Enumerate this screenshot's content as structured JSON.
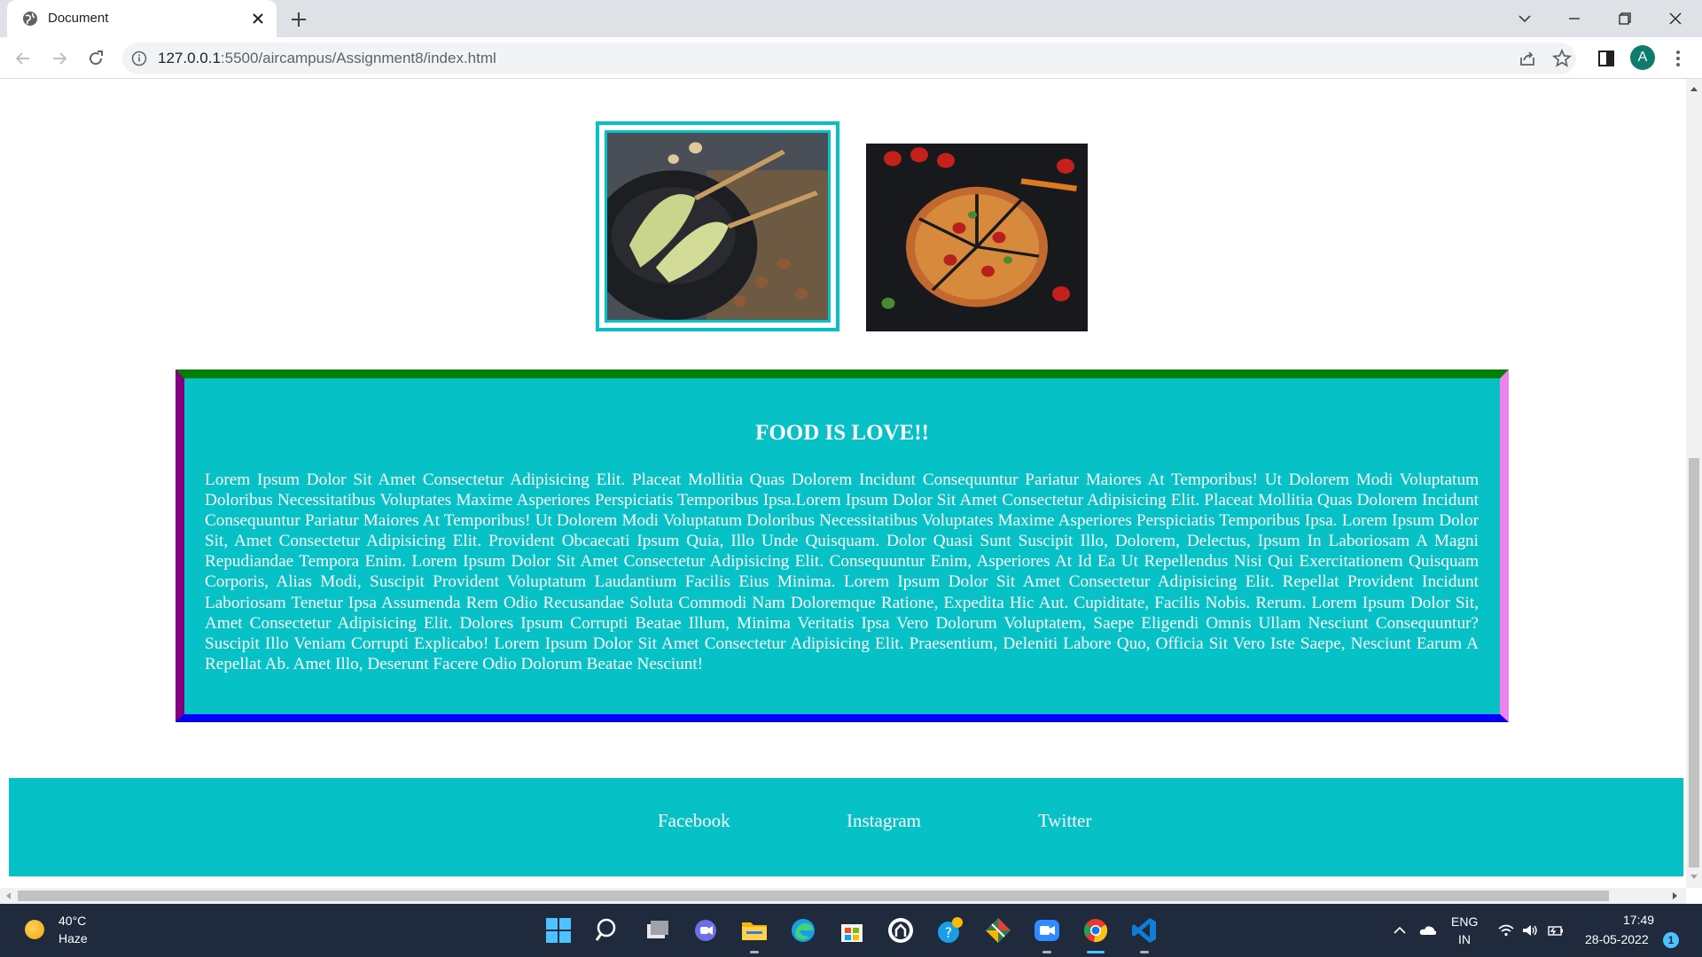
{
  "browser": {
    "tab_title": "Document",
    "url_host": "127.0.0.1",
    "url_rest": ":5500/aircampus/Assignment8/index.html",
    "avatar_letter": "A"
  },
  "page": {
    "heading": "FOOD IS LOVE!!",
    "paragraph": "Lorem Ipsum Dolor Sit Amet Consectetur Adipisicing Elit. Placeat Mollitia Quas Dolorem Incidunt Consequuntur Pariatur Maiores At Temporibus! Ut Dolorem Modi Voluptatum Doloribus Necessitatibus Voluptates Maxime Asperiores Perspiciatis Temporibus Ipsa.Lorem Ipsum Dolor Sit Amet Consectetur Adipisicing Elit. Placeat Mollitia Quas Dolorem Incidunt Consequuntur Pariatur Maiores At Temporibus! Ut Dolorem Modi Voluptatum Doloribus Necessitatibus Voluptates Maxime Asperiores Perspiciatis Temporibus Ipsa. Lorem Ipsum Dolor Sit, Amet Consectetur Adipisicing Elit. Provident Obcaecati Ipsum Quia, Illo Unde Quisquam. Dolor Quasi Sunt Suscipit Illo, Dolorem, Delectus, Ipsum In Laboriosam A Magni Repudiandae Tempora Enim. Lorem Ipsum Dolor Sit Amet Consectetur Adipisicing Elit. Consequuntur Enim, Asperiores At Id Ea Ut Repellendus Nisi Qui Exercitationem Quisquam Corporis, Alias Modi, Suscipit Provident Voluptatum Laudantium Facilis Eius Minima. Lorem Ipsum Dolor Sit Amet Consectetur Adipisicing Elit. Repellat Provident Incidunt Laboriosam Tenetur Ipsa Assumenda Rem Odio Recusandae Soluta Commodi Nam Doloremque Ratione, Expedita Hic Aut. Cupiditate, Facilis Nobis. Rerum. Lorem Ipsum Dolor Sit, Amet Consectetur Adipisicing Elit. Dolores Ipsum Corrupti Beatae Illum, Minima Veritatis Ipsa Vero Dolorum Voluptatem, Saepe Eligendi Omnis Ullam Nesciunt Consequuntur? Suscipit Illo Veniam Corrupti Explicabo! Lorem Ipsum Dolor Sit Amet Consectetur Adipisicing Elit. Praesentium, Deleniti Labore Quo, Officia Sit Vero Iste Saepe, Nesciunt Earum A Repellat Ab. Amet Illo, Deserunt Facere Odio Dolorum Beatae Nesciunt!",
    "footer_links": [
      "Facebook",
      "Instagram",
      "Twitter"
    ],
    "images": [
      "kulfi-image",
      "pizza-image"
    ]
  },
  "colors": {
    "accent_cyan": "#06c1c6",
    "border_top": "#008000",
    "border_right": "#ee82ee",
    "border_bottom": "#0000ff",
    "border_left": "#800080"
  },
  "taskbar": {
    "temperature": "40°C",
    "weather": "Haze",
    "lang_line1": "ENG",
    "lang_line2": "IN",
    "time": "17:49",
    "date": "28-05-2022",
    "notification_count": "1"
  }
}
